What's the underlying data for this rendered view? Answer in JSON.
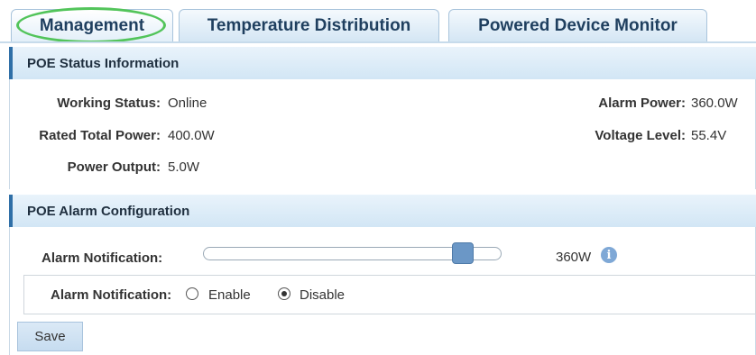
{
  "tabs": [
    {
      "label": "Management"
    },
    {
      "label": "Temperature Distribution"
    },
    {
      "label": "Powered Device Monitor"
    }
  ],
  "status_section": {
    "title": "POE Status Information",
    "working_status": {
      "label": "Working Status:",
      "value": "Online"
    },
    "rated_total_power": {
      "label": "Rated Total Power:",
      "value": "400.0W"
    },
    "power_output": {
      "label": "Power Output:",
      "value": "5.0W"
    },
    "alarm_power": {
      "label": "Alarm Power:",
      "value": "360.0W"
    },
    "voltage_level": {
      "label": "Voltage Level:",
      "value": "55.4V"
    }
  },
  "alarm_section": {
    "title": "POE Alarm Configuration",
    "slider_label": "Alarm Notification:",
    "slider_value": "360W",
    "slider_fraction": 0.9,
    "notification_label": "Alarm Notification:",
    "enable_label": "Enable",
    "disable_label": "Disable",
    "selected": "Disable"
  },
  "save_label": "Save",
  "colors": {
    "active_tab_ring": "#52c45a",
    "section_accent": "#2f6fa7",
    "slider_handle": "#6b97c6"
  },
  "icons": {
    "info": "info-icon"
  }
}
